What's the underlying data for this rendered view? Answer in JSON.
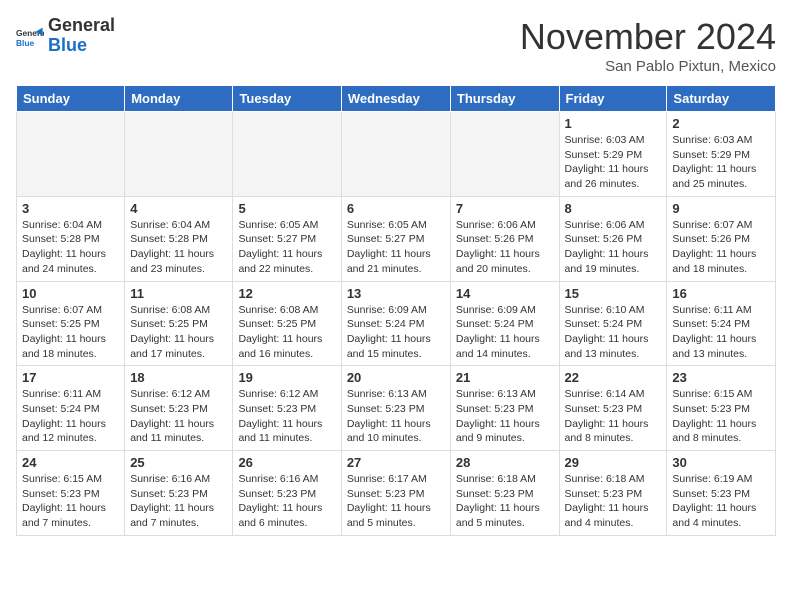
{
  "header": {
    "logo": {
      "general": "General",
      "blue": "Blue"
    },
    "title": "November 2024",
    "location": "San Pablo Pixtun, Mexico"
  },
  "weekdays": [
    "Sunday",
    "Monday",
    "Tuesday",
    "Wednesday",
    "Thursday",
    "Friday",
    "Saturday"
  ],
  "weeks": [
    [
      {
        "day": "",
        "info": ""
      },
      {
        "day": "",
        "info": ""
      },
      {
        "day": "",
        "info": ""
      },
      {
        "day": "",
        "info": ""
      },
      {
        "day": "",
        "info": ""
      },
      {
        "day": "1",
        "info": "Sunrise: 6:03 AM\nSunset: 5:29 PM\nDaylight: 11 hours and 26 minutes."
      },
      {
        "day": "2",
        "info": "Sunrise: 6:03 AM\nSunset: 5:29 PM\nDaylight: 11 hours and 25 minutes."
      }
    ],
    [
      {
        "day": "3",
        "info": "Sunrise: 6:04 AM\nSunset: 5:28 PM\nDaylight: 11 hours and 24 minutes."
      },
      {
        "day": "4",
        "info": "Sunrise: 6:04 AM\nSunset: 5:28 PM\nDaylight: 11 hours and 23 minutes."
      },
      {
        "day": "5",
        "info": "Sunrise: 6:05 AM\nSunset: 5:27 PM\nDaylight: 11 hours and 22 minutes."
      },
      {
        "day": "6",
        "info": "Sunrise: 6:05 AM\nSunset: 5:27 PM\nDaylight: 11 hours and 21 minutes."
      },
      {
        "day": "7",
        "info": "Sunrise: 6:06 AM\nSunset: 5:26 PM\nDaylight: 11 hours and 20 minutes."
      },
      {
        "day": "8",
        "info": "Sunrise: 6:06 AM\nSunset: 5:26 PM\nDaylight: 11 hours and 19 minutes."
      },
      {
        "day": "9",
        "info": "Sunrise: 6:07 AM\nSunset: 5:26 PM\nDaylight: 11 hours and 18 minutes."
      }
    ],
    [
      {
        "day": "10",
        "info": "Sunrise: 6:07 AM\nSunset: 5:25 PM\nDaylight: 11 hours and 18 minutes."
      },
      {
        "day": "11",
        "info": "Sunrise: 6:08 AM\nSunset: 5:25 PM\nDaylight: 11 hours and 17 minutes."
      },
      {
        "day": "12",
        "info": "Sunrise: 6:08 AM\nSunset: 5:25 PM\nDaylight: 11 hours and 16 minutes."
      },
      {
        "day": "13",
        "info": "Sunrise: 6:09 AM\nSunset: 5:24 PM\nDaylight: 11 hours and 15 minutes."
      },
      {
        "day": "14",
        "info": "Sunrise: 6:09 AM\nSunset: 5:24 PM\nDaylight: 11 hours and 14 minutes."
      },
      {
        "day": "15",
        "info": "Sunrise: 6:10 AM\nSunset: 5:24 PM\nDaylight: 11 hours and 13 minutes."
      },
      {
        "day": "16",
        "info": "Sunrise: 6:11 AM\nSunset: 5:24 PM\nDaylight: 11 hours and 13 minutes."
      }
    ],
    [
      {
        "day": "17",
        "info": "Sunrise: 6:11 AM\nSunset: 5:24 PM\nDaylight: 11 hours and 12 minutes."
      },
      {
        "day": "18",
        "info": "Sunrise: 6:12 AM\nSunset: 5:23 PM\nDaylight: 11 hours and 11 minutes."
      },
      {
        "day": "19",
        "info": "Sunrise: 6:12 AM\nSunset: 5:23 PM\nDaylight: 11 hours and 11 minutes."
      },
      {
        "day": "20",
        "info": "Sunrise: 6:13 AM\nSunset: 5:23 PM\nDaylight: 11 hours and 10 minutes."
      },
      {
        "day": "21",
        "info": "Sunrise: 6:13 AM\nSunset: 5:23 PM\nDaylight: 11 hours and 9 minutes."
      },
      {
        "day": "22",
        "info": "Sunrise: 6:14 AM\nSunset: 5:23 PM\nDaylight: 11 hours and 8 minutes."
      },
      {
        "day": "23",
        "info": "Sunrise: 6:15 AM\nSunset: 5:23 PM\nDaylight: 11 hours and 8 minutes."
      }
    ],
    [
      {
        "day": "24",
        "info": "Sunrise: 6:15 AM\nSunset: 5:23 PM\nDaylight: 11 hours and 7 minutes."
      },
      {
        "day": "25",
        "info": "Sunrise: 6:16 AM\nSunset: 5:23 PM\nDaylight: 11 hours and 7 minutes."
      },
      {
        "day": "26",
        "info": "Sunrise: 6:16 AM\nSunset: 5:23 PM\nDaylight: 11 hours and 6 minutes."
      },
      {
        "day": "27",
        "info": "Sunrise: 6:17 AM\nSunset: 5:23 PM\nDaylight: 11 hours and 5 minutes."
      },
      {
        "day": "28",
        "info": "Sunrise: 6:18 AM\nSunset: 5:23 PM\nDaylight: 11 hours and 5 minutes."
      },
      {
        "day": "29",
        "info": "Sunrise: 6:18 AM\nSunset: 5:23 PM\nDaylight: 11 hours and 4 minutes."
      },
      {
        "day": "30",
        "info": "Sunrise: 6:19 AM\nSunset: 5:23 PM\nDaylight: 11 hours and 4 minutes."
      }
    ]
  ]
}
